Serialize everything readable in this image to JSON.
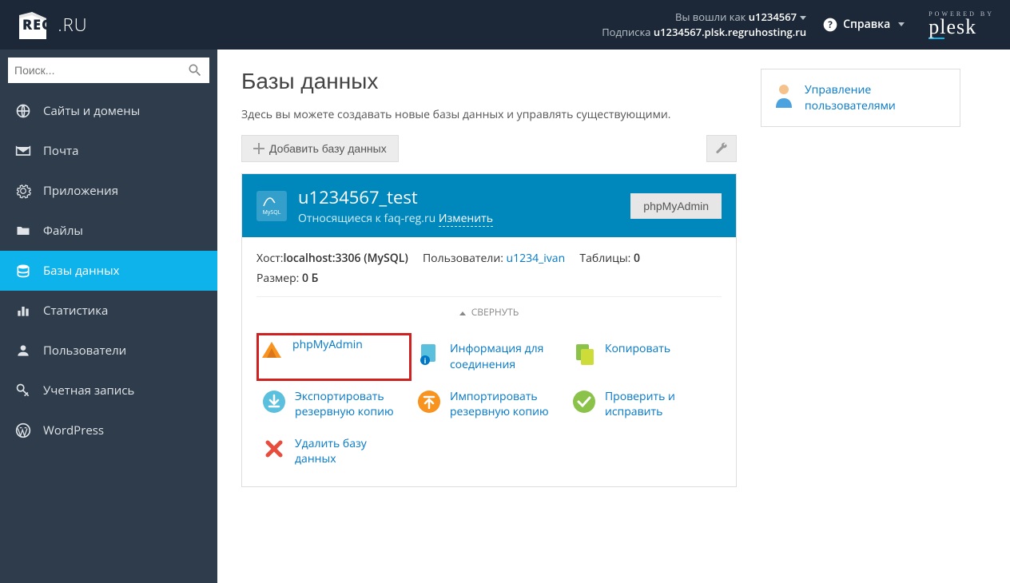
{
  "header": {
    "logged_in_as_label": "Вы вошли как",
    "username": "u1234567",
    "subscription_label": "Подписка",
    "subscription_value": "u1234567.plsk.regruhosting.ru",
    "help_label": "Справка",
    "powered_by": "POWERED BY",
    "plesk": "plesk",
    "logo": "REG.RU"
  },
  "search": {
    "placeholder": "Поиск..."
  },
  "sidebar": {
    "items": [
      {
        "label": "Сайты и домены",
        "icon": "globe"
      },
      {
        "label": "Почта",
        "icon": "mail"
      },
      {
        "label": "Приложения",
        "icon": "gear"
      },
      {
        "label": "Файлы",
        "icon": "folder"
      },
      {
        "label": "Базы данных",
        "icon": "database",
        "active": true
      },
      {
        "label": "Статистика",
        "icon": "stats"
      },
      {
        "label": "Пользователи",
        "icon": "user"
      },
      {
        "label": "Учетная запись",
        "icon": "key"
      },
      {
        "label": "WordPress",
        "icon": "wordpress"
      }
    ]
  },
  "page": {
    "title": "Базы данных",
    "description": "Здесь вы можете создавать новые базы данных и управлять существующими.",
    "add_button": "Добавить базу данных"
  },
  "db": {
    "name": "u1234567_test",
    "related_prefix": "Относящиеся к ",
    "related_domain": "faq-reg.ru",
    "change_link": "Изменить",
    "phpmyadmin_btn": "phpMyAdmin",
    "host_label": "Хост:",
    "host_value": "localhost:3306 (MySQL)",
    "users_label": "Пользователи:",
    "users_value": "u1234_ivan",
    "tables_label": "Таблицы:",
    "tables_value": "0",
    "size_label": "Размер:",
    "size_value": "0 Б",
    "collapse": "СВЕРНУТЬ"
  },
  "actions": {
    "phpmyadmin": "phpMyAdmin",
    "connection_info": "Информация для соединения",
    "copy": "Копировать",
    "export": "Экспортировать резервную копию",
    "import": "Импортировать резервную копию",
    "check": "Проверить и исправить",
    "delete": "Удалить базу данных"
  },
  "side_panel": {
    "user_management": "Управление пользователями"
  }
}
